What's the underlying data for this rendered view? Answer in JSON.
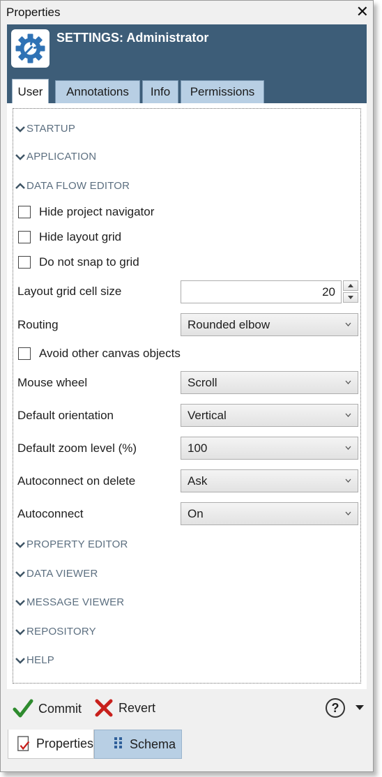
{
  "window": {
    "title": "Properties",
    "close_glyph": "✕"
  },
  "header": {
    "icon": "gear-wrench-icon",
    "title": "SETTINGS: Administrator"
  },
  "tabs": [
    {
      "label": "User",
      "active": true
    },
    {
      "label": "Annotations",
      "active": false
    },
    {
      "label": "Info",
      "active": false
    },
    {
      "label": "Permissions",
      "active": false
    }
  ],
  "sections": {
    "startup": {
      "label": "STARTUP",
      "expanded": false
    },
    "application": {
      "label": "APPLICATION",
      "expanded": false
    },
    "data_flow_editor": {
      "label": "DATA FLOW EDITOR",
      "expanded": true
    },
    "property_editor": {
      "label": "PROPERTY EDITOR",
      "expanded": false
    },
    "data_viewer": {
      "label": "DATA VIEWER",
      "expanded": false
    },
    "message_viewer": {
      "label": "MESSAGE VIEWER",
      "expanded": false
    },
    "repository": {
      "label": "REPOSITORY",
      "expanded": false
    },
    "help": {
      "label": "HELP",
      "expanded": false
    }
  },
  "settings": {
    "hide_project_navigator": {
      "label": "Hide project navigator",
      "checked": false
    },
    "hide_layout_grid": {
      "label": "Hide layout grid",
      "checked": false
    },
    "do_not_snap": {
      "label": "Do not snap to grid",
      "checked": false
    },
    "grid_cell_size": {
      "label": "Layout grid cell size",
      "value": "20"
    },
    "routing": {
      "label": "Routing",
      "value": "Rounded elbow"
    },
    "avoid_objects": {
      "label": "Avoid other canvas objects",
      "checked": false
    },
    "mouse_wheel": {
      "label": "Mouse wheel",
      "value": "Scroll"
    },
    "default_orientation": {
      "label": "Default orientation",
      "value": "Vertical"
    },
    "default_zoom": {
      "label": "Default zoom level (%)",
      "value": "100"
    },
    "autoconnect_on_delete": {
      "label": "Autoconnect on delete",
      "value": "Ask"
    },
    "autoconnect": {
      "label": "Autoconnect",
      "value": "On"
    }
  },
  "toolbar": {
    "commit_label": "Commit",
    "revert_label": "Revert",
    "help_glyph": "?",
    "colors": {
      "commit": "#2e8b2e",
      "revert": "#c8201c"
    }
  },
  "bottom_tabs": [
    {
      "label": "Properties",
      "icon": "properties-checklist-icon",
      "active": true
    },
    {
      "label": "Schema",
      "icon": "schema-columns-icon",
      "active": false
    }
  ],
  "colors": {
    "header": "#3d5d78",
    "tab": "#b8cfe4",
    "section_text": "#5c6f80"
  }
}
